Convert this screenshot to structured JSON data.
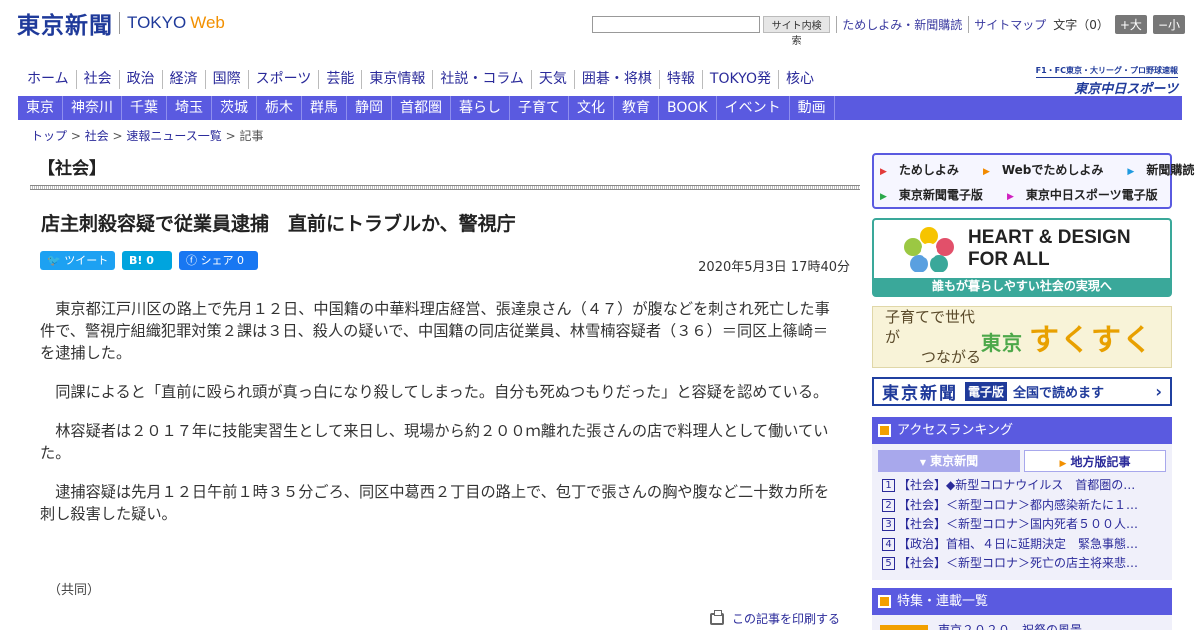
{
  "header": {
    "logo_jp": "東京新聞",
    "logo_en": "TOKYO",
    "logo_web": "Web",
    "search_placeholder": "",
    "search_button": "サイト内検索",
    "links": [
      "ためしよみ・新聞購読",
      "サイトマップ"
    ],
    "fontsize_label": "文字（0）",
    "size_up": "+大",
    "size_down": "−小"
  },
  "main_nav": [
    "ホーム",
    "社会",
    "政治",
    "経済",
    "国際",
    "スポーツ",
    "芸能",
    "東京情報",
    "社説・コラム",
    "天気",
    "囲碁・将棋",
    "特報",
    "TOKYO発",
    "核心"
  ],
  "chunichi_banner": {
    "line1": "F1・FC東京・大リーグ・プロ野球速報",
    "line2": "東京中日スポーツ"
  },
  "sub_nav": [
    "東京",
    "神奈川",
    "千葉",
    "埼玉",
    "茨城",
    "栃木",
    "群馬",
    "静岡",
    "首都圏",
    "暮らし",
    "子育て",
    "文化",
    "教育",
    "BOOK",
    "イベント",
    "動画"
  ],
  "breadcrumb": {
    "items": [
      "トップ",
      "社会",
      "速報ニュース一覧"
    ],
    "current": "記事",
    "sep": " > "
  },
  "article": {
    "section": "【社会】",
    "headline": "店主刺殺容疑で従業員逮捕　直前にトラブルか、警視庁",
    "share": {
      "tweet": "ツイート",
      "hatena": "B!  0",
      "facebook": "シェア 0"
    },
    "date": "2020年5月3日 17時40分",
    "paragraphs": [
      "東京都江戸川区の路上で先月１２日、中国籍の中華料理店経営、張達泉さん（４７）が腹などを刺され死亡した事件で、警視庁組織犯罪対策２課は３日、殺人の疑いで、中国籍の同店従業員、林雪楠容疑者（３６）＝同区上篠崎＝を逮捕した。",
      "同課によると「直前に殴られ頭が真っ白になり殺してしまった。自分も死ぬつもりだった」と容疑を認めている。",
      "林容疑者は２０１７年に技能実習生として来日し、現場から約２００ｍ離れた張さんの店で料理人として働いていた。",
      "逮捕容疑は先月１２日午前１時３５分ごろ、同区中葛西２丁目の路上で、包丁で張さんの胸や腹など二十数カ所を刺し殺害した疑い。"
    ],
    "source": "（共同）",
    "print_label": "この記事を印刷する"
  },
  "sidebar": {
    "promo_links": [
      {
        "label": "ためしよみ",
        "color": "#e23a3a"
      },
      {
        "label": "Webでためしよみ",
        "color": "#f28a00"
      },
      {
        "label": "新聞購読",
        "color": "#1f9adf"
      },
      {
        "label": "東京新聞電子版",
        "color": "#2aa84a"
      },
      {
        "label": "東京中日スポーツ電子版",
        "color": "#d020c0"
      }
    ],
    "heart": {
      "line1": "HEART & DESIGN",
      "line2": "FOR ALL",
      "footer": "誰もが暮らしやすい社会の実現へ"
    },
    "sukusuku": {
      "left1": "子育てで世代が",
      "left2": "つながる",
      "brand_small": "東京",
      "brand": "すくすく"
    },
    "epaper": {
      "name": "東京新聞",
      "badge": "電子版",
      "text": "全国で読めます",
      "arrow": "›"
    },
    "ranking": {
      "title": "アクセスランキング",
      "tabs": [
        "東京新聞",
        "地方版記事"
      ],
      "items": [
        "【社会】◆新型コロナウイルス　首都圏の…",
        "【社会】＜新型コロナ＞都内感染新たに１…",
        "【社会】＜新型コロナ＞国内死者５００人…",
        "【政治】首相、４日に延期決定　緊急事態…",
        "【社会】＜新型コロナ＞死亡の店主将来悲…"
      ]
    },
    "feature": {
      "title": "特集・連載一覧",
      "strip_text": "東京２０２０　祝祭の風景"
    }
  },
  "colors": {
    "nav_bar": "#5a5ae0",
    "brand_blue": "#1f3a9a",
    "brand_orange": "#f29000",
    "heart_teal": "#3aa89a"
  }
}
